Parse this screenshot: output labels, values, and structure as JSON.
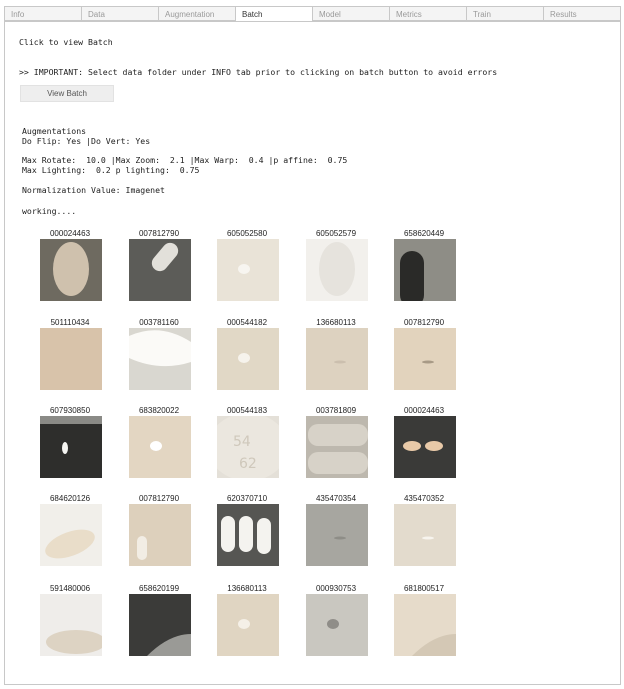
{
  "tabs": [
    {
      "label": "Info",
      "name": "tab-info",
      "active": false
    },
    {
      "label": "Data",
      "name": "tab-data",
      "active": false
    },
    {
      "label": "Augmentation",
      "name": "tab-augmentation",
      "active": false
    },
    {
      "label": "Batch",
      "name": "tab-batch",
      "active": true
    },
    {
      "label": "Model",
      "name": "tab-model",
      "active": false
    },
    {
      "label": "Metrics",
      "name": "tab-metrics",
      "active": false
    },
    {
      "label": "Train",
      "name": "tab-train",
      "active": false
    },
    {
      "label": "Results",
      "name": "tab-results",
      "active": false
    }
  ],
  "batch": {
    "click_hint": "Click to view Batch",
    "important": ">> IMPORTANT: Select data folder under INFO tab prior to clicking on batch button to avoid errors",
    "view_button": "View Batch",
    "aug_title": "Augmentations",
    "flip_line": "Do Flip: Yes |Do Vert: Yes",
    "rotate_line": "Max Rotate:  10.0 |Max Zoom:  2.1 |Max Warp:  0.4 |p affine:  0.75",
    "lighting_line": "Max Lighting:  0.2 p lighting:  0.75",
    "norm_line": "Normalization Value: Imagenet",
    "status": "working...."
  },
  "images": [
    {
      "label": "000024463",
      "bg": "#6e6a60",
      "fg": "#cfc1ad",
      "shape": "oval-tall"
    },
    {
      "label": "007812790",
      "bg": "#5c5c58",
      "fg": "#e2e0da",
      "shape": "capsule-diag"
    },
    {
      "label": "605052580",
      "bg": "#e9e3d7",
      "fg": "#f7f5f0",
      "shape": "dot"
    },
    {
      "label": "605052579",
      "bg": "#f2f0ec",
      "fg": "#e6e3dd",
      "shape": "oval-tall"
    },
    {
      "label": "658620449",
      "bg": "#8e8d86",
      "fg": "#2a2a28",
      "shape": "capsule-v"
    },
    {
      "label": "501110434",
      "bg": "#d8c3aa",
      "fg": "#d8c3aa",
      "shape": "none"
    },
    {
      "label": "003781160",
      "bg": "#d9d7d0",
      "fg": "#fbfaf7",
      "shape": "half-round"
    },
    {
      "label": "000544182",
      "bg": "#e1d8c6",
      "fg": "#f6f3ec",
      "shape": "dot"
    },
    {
      "label": "136680113",
      "bg": "#ddd2c0",
      "fg": "#cbbfae",
      "shape": "dash"
    },
    {
      "label": "007812790",
      "bg": "#e2d3bd",
      "fg": "#a89a86",
      "shape": "dash"
    },
    {
      "label": "607930850",
      "bg": "#2e2e2c",
      "fg": "#f5f5f2",
      "shape": "dot-dark"
    },
    {
      "label": "683820022",
      "bg": "#e3d6c2",
      "fg": "#ffffff",
      "shape": "dot"
    },
    {
      "label": "000544183",
      "bg": "#e4e0d8",
      "fg": "#cfc8bb",
      "shape": "text-54"
    },
    {
      "label": "003781809",
      "bg": "#bdb8ae",
      "fg": "#d7d2c8",
      "shape": "tablets"
    },
    {
      "label": "000024463",
      "bg": "#3a3a38",
      "fg": "#e8c9a8",
      "shape": "two-ovals"
    },
    {
      "label": "684620126",
      "bg": "#f1efea",
      "fg": "#e9ddc9",
      "shape": "oval-wide"
    },
    {
      "label": "007812790",
      "bg": "#ddd0bc",
      "fg": "#f2ede4",
      "shape": "capsule-v-small"
    },
    {
      "label": "620370710",
      "bg": "#565653",
      "fg": "#f4f3ef",
      "shape": "three-caps"
    },
    {
      "label": "435470354",
      "bg": "#a7a6a0",
      "fg": "#8e8d87",
      "shape": "dash"
    },
    {
      "label": "435470352",
      "bg": "#e3dbcd",
      "fg": "#f7f4ee",
      "shape": "dash"
    },
    {
      "label": "591480006",
      "bg": "#efedea",
      "fg": "#ddd3c3",
      "shape": "pill-text"
    },
    {
      "label": "658620199",
      "bg": "#3b3b39",
      "fg": "#9a9a96",
      "shape": "arc"
    },
    {
      "label": "136680113",
      "bg": "#e0d5c2",
      "fg": "#f5f0e7",
      "shape": "dot"
    },
    {
      "label": "000930753",
      "bg": "#c9c7c0",
      "fg": "#8f8d88",
      "shape": "dot"
    },
    {
      "label": "681800517",
      "bg": "#e6dbca",
      "fg": "#d4c8b5",
      "shape": "arc"
    }
  ]
}
